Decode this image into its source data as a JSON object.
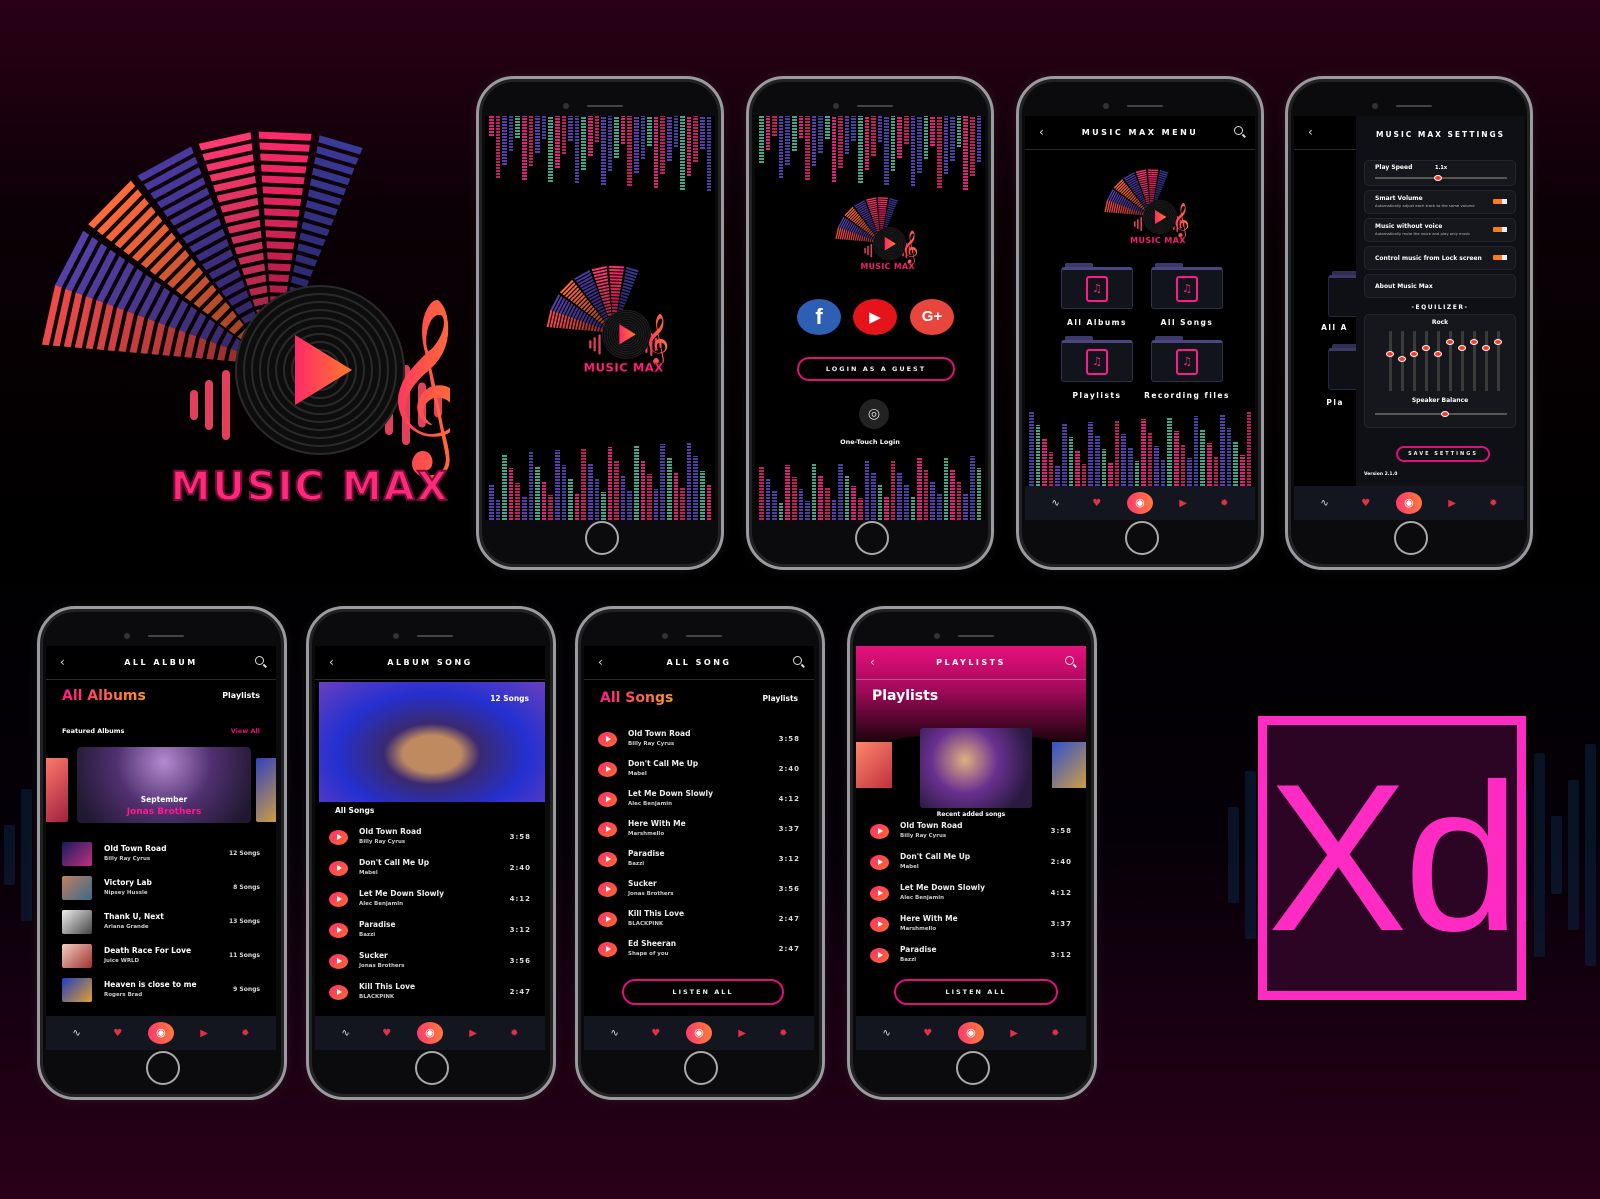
{
  "brand": {
    "logo_text": "MUSIC MAX"
  },
  "xd_logo": "Xd",
  "colors": {
    "accent_pink": "#e0107a",
    "accent_orange": "#ff7a1a",
    "xd_magenta": "#ff2bc2",
    "background": "#000000"
  },
  "nav_icons": [
    "pulse-icon",
    "fox-icon",
    "broadcast-icon",
    "youtube-icon",
    "gear-icon"
  ],
  "login": {
    "social": [
      "f",
      "▶",
      "G+"
    ],
    "guest_button": "LOGIN AS A GUEST",
    "one_touch": "One-Touch Login"
  },
  "menu": {
    "title": "MUSIC MAX MENU",
    "items": [
      "All Albums",
      "All Songs",
      "Playlists",
      "Recording files"
    ]
  },
  "settings": {
    "title": "MUSIC MAX SETTINGS",
    "play_speed_label": "Play Speed",
    "play_speed_value": "1.1x",
    "play_speed_fraction": 0.45,
    "smart_volume": {
      "label": "Smart Volume",
      "desc": "Automatically adjust each track to the same volume",
      "on": true
    },
    "music_without_voice": {
      "label": "Music without voice",
      "desc": "Automatically mute the voice and play only music",
      "on": true
    },
    "lock_screen": {
      "label": "Control music from Lock screen",
      "on": true
    },
    "about": "About Music Max",
    "equalizer_title": "-EQUILIZER-",
    "preset": "Rock",
    "eq_levels": [
      0.35,
      0.45,
      0.35,
      0.25,
      0.35,
      0.15,
      0.25,
      0.15,
      0.25,
      0.15
    ],
    "speaker_balance_label": "Speaker Balance",
    "speaker_balance_fraction": 0.5,
    "save_button": "SAVE SETTINGS",
    "version": "Version 2.1.0",
    "behind_labels": [
      "All A",
      "Pla"
    ]
  },
  "all_album": {
    "title": "ALL ALBUM",
    "heading": "All Albums",
    "tab_playlists": "Playlists",
    "featured_label": "Featured Albums",
    "view_all": "View All",
    "featured": {
      "title": "September",
      "artist": "Jonas Brothers"
    },
    "albums": [
      {
        "title": "Old Town Road",
        "artist": "Billy Ray Cyrus",
        "count": "12 Songs"
      },
      {
        "title": "Victory Lab",
        "artist": "Nipsey Hussle",
        "count": "8  Songs"
      },
      {
        "title": "Thank U, Next",
        "artist": "Ariana Grande",
        "count": "13 Songs"
      },
      {
        "title": "Death Race For Love",
        "artist": "Juice WRLD",
        "count": "11 Songs"
      },
      {
        "title": "Heaven is close to me",
        "artist": "Rogers Brad",
        "count": "9 Songs"
      }
    ]
  },
  "album_song": {
    "title": "ALBUM SONG",
    "count": "12 Songs",
    "section": "All Songs",
    "songs": [
      {
        "title": "Old Town Road",
        "artist": "Billy Ray Cyrus",
        "duration": "3:58"
      },
      {
        "title": "Don't Call Me Up",
        "artist": "Mabel",
        "duration": "2:40"
      },
      {
        "title": "Let Me Down Slowly",
        "artist": "Alec Benjamin",
        "duration": "4:12"
      },
      {
        "title": "Paradise",
        "artist": "Bazzi",
        "duration": "3:12"
      },
      {
        "title": "Sucker",
        "artist": "Jonas Brothers",
        "duration": "3:56"
      },
      {
        "title": "Kill This Love",
        "artist": "BLACKPINK",
        "duration": "2:47"
      }
    ]
  },
  "all_song": {
    "title": "ALL SONG",
    "heading": "All Songs",
    "tab_playlists": "Playlists",
    "listen_all": "LISTEN ALL",
    "songs": [
      {
        "title": "Old Town Road",
        "artist": "Billy Ray Cyrus",
        "duration": "3:58"
      },
      {
        "title": "Don't Call Me Up",
        "artist": "Mabel",
        "duration": "2:40"
      },
      {
        "title": "Let Me Down Slowly",
        "artist": "Alec Benjamin",
        "duration": "4:12"
      },
      {
        "title": "Here With Me",
        "artist": "Marshmello",
        "duration": "3:37"
      },
      {
        "title": "Paradise",
        "artist": "Bazzi",
        "duration": "3:12"
      },
      {
        "title": "Sucker",
        "artist": "Jonas Brothers",
        "duration": "3:56"
      },
      {
        "title": "Kill This Love",
        "artist": "BLACKPINK",
        "duration": "2:47"
      },
      {
        "title": "Ed Sheeran",
        "artist": "Shape of you",
        "duration": "2:47"
      }
    ]
  },
  "playlists": {
    "title": "PLAYLISTS",
    "heading": "Playlists",
    "caption": "Recent added songs",
    "listen_all": "LISTEN ALL",
    "songs": [
      {
        "title": "Old Town Road",
        "artist": "Billy Ray Cyrus",
        "duration": "3:58"
      },
      {
        "title": "Don't Call Me Up",
        "artist": "Mabel",
        "duration": "2:40"
      },
      {
        "title": "Let Me Down Slowly",
        "artist": "Alec Benjamin",
        "duration": "4:12"
      },
      {
        "title": "Here With Me",
        "artist": "Marshmello",
        "duration": "3:37"
      },
      {
        "title": "Paradise",
        "artist": "Bazzi",
        "duration": "3:12"
      }
    ]
  }
}
